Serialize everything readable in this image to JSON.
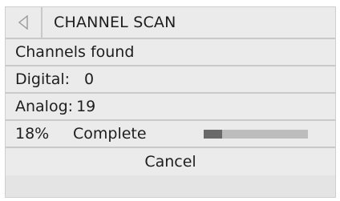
{
  "title": "CHANNEL SCAN",
  "icons": {
    "back": "back-triangle-icon"
  },
  "rows": {
    "channels_found": "Channels found",
    "digital_label": "Digital:",
    "digital_value": "0",
    "analog_label": "Analog:",
    "analog_value": "19"
  },
  "progress": {
    "percent_text": "18%",
    "status_text": "Complete",
    "fraction": 0.18
  },
  "cancel_label": "Cancel",
  "colors": {
    "background": "#e4e4e4",
    "bar_track": "#bdbdbd",
    "bar_fill": "#6a6a6a",
    "text": "#1e1e1e"
  }
}
